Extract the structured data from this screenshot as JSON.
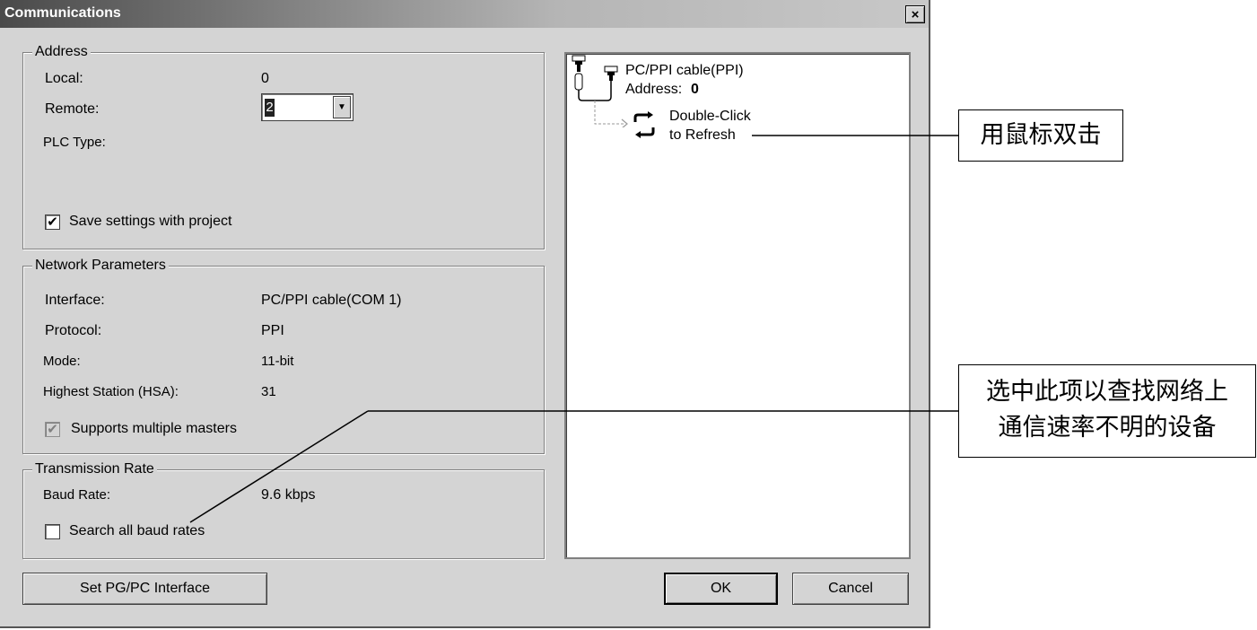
{
  "window": {
    "title": "Communications",
    "close_glyph": "×"
  },
  "address": {
    "legend": "Address",
    "local_label": "Local:",
    "local_value": "0",
    "remote_label": "Remote:",
    "remote_value": "2",
    "plc_type_label": "PLC Type:",
    "save_settings_label": "Save settings with project",
    "save_settings_checked": true
  },
  "network": {
    "legend": "Network Parameters",
    "interface_label": "Interface:",
    "interface_value": "PC/PPI cable(COM 1)",
    "protocol_label": "Protocol:",
    "protocol_value": "PPI",
    "mode_label": "Mode:",
    "mode_value": "11-bit",
    "hsa_label": "Highest Station (HSA):",
    "hsa_value": "31",
    "multi_masters_label": "Supports multiple masters",
    "multi_masters_checked": true
  },
  "transmission": {
    "legend": "Transmission Rate",
    "baud_label": "Baud Rate:",
    "baud_value": "9.6 kbps",
    "search_all_label": "Search all baud rates",
    "search_all_checked": false
  },
  "tree": {
    "cable_label": "PC/PPI cable(PPI)",
    "address_label": "Address:",
    "address_value": "0",
    "refresh_line1": "Double-Click",
    "refresh_line2": "to Refresh"
  },
  "buttons": {
    "set_interface": "Set PG/PC Interface",
    "ok": "OK",
    "cancel": "Cancel"
  },
  "annotations": {
    "double_click": "用鼠标双击",
    "search_line1": "选中此项以查找网络上",
    "search_line2": "通信速率不明的设备"
  },
  "icons": [
    "close-icon",
    "dropdown-arrow-icon",
    "checkmark-icon",
    "cable-connector-icon",
    "refresh-icon"
  ]
}
